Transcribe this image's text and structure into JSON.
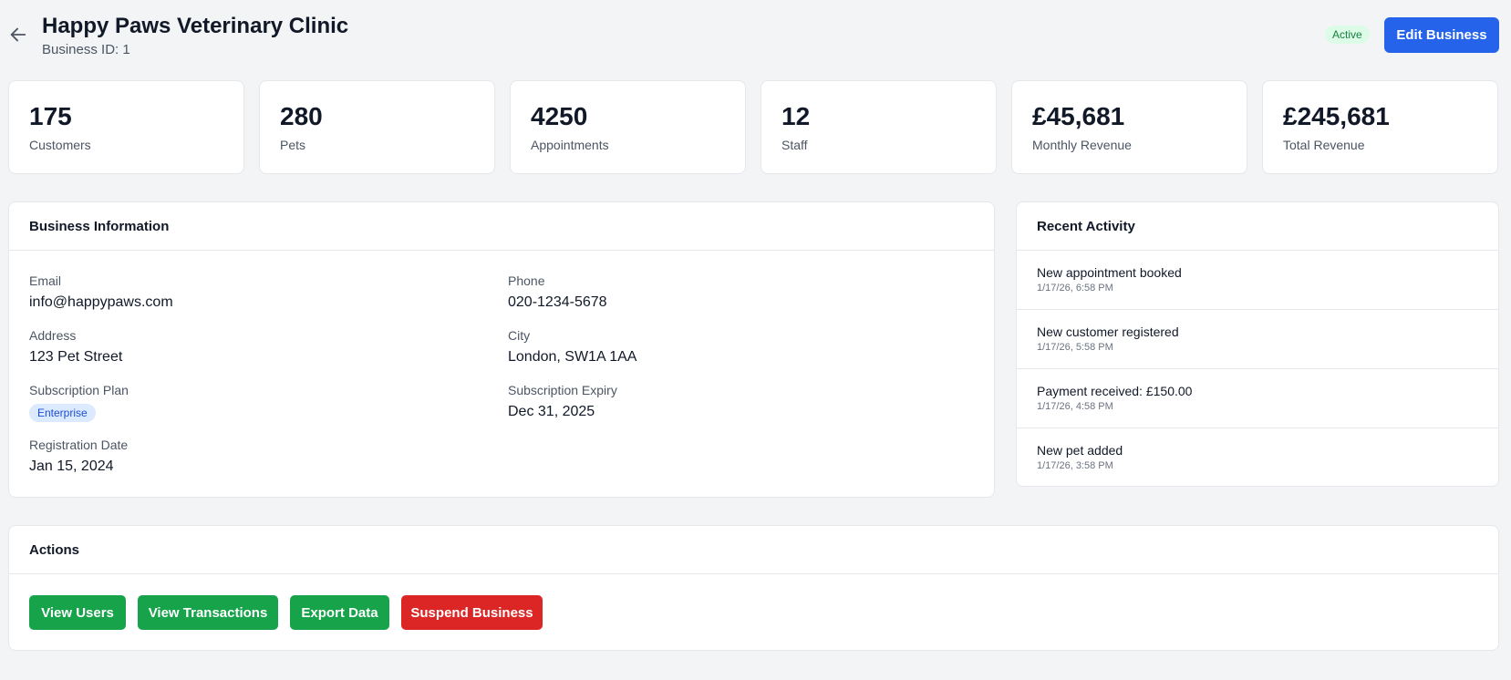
{
  "header": {
    "title": "Happy Paws Veterinary Clinic",
    "subtitle": "Business ID: 1",
    "status": "Active",
    "edit_label": "Edit Business",
    "back_icon": "arrow-left-icon"
  },
  "stats": [
    {
      "value": "175",
      "label": "Customers"
    },
    {
      "value": "280",
      "label": "Pets"
    },
    {
      "value": "4250",
      "label": "Appointments"
    },
    {
      "value": "12",
      "label": "Staff"
    },
    {
      "value": "£45,681",
      "label": "Monthly Revenue"
    },
    {
      "value": "£245,681",
      "label": "Total Revenue"
    }
  ],
  "business_info": {
    "title": "Business Information",
    "email_label": "Email",
    "email": "info@happypaws.com",
    "phone_label": "Phone",
    "phone": "020-1234-5678",
    "address_label": "Address",
    "address": "123 Pet Street",
    "city_label": "City",
    "city": "London, SW1A 1AA",
    "plan_label": "Subscription Plan",
    "plan": "Enterprise",
    "expiry_label": "Subscription Expiry",
    "expiry": "Dec 31, 2025",
    "registration_label": "Registration Date",
    "registration": "Jan 15, 2024"
  },
  "activity": {
    "title": "Recent Activity",
    "items": [
      {
        "title": "New appointment booked",
        "time": "1/17/26, 6:58 PM"
      },
      {
        "title": "New customer registered",
        "time": "1/17/26, 5:58 PM"
      },
      {
        "title": "Payment received: £150.00",
        "time": "1/17/26, 4:58 PM"
      },
      {
        "title": "New pet added",
        "time": "1/17/26, 3:58 PM"
      }
    ]
  },
  "actions": {
    "title": "Actions",
    "view_users": "View Users",
    "view_transactions": "View Transactions",
    "export_data": "Export Data",
    "suspend": "Suspend Business"
  },
  "colors": {
    "primary": "#2563eb",
    "success": "#16a34a",
    "danger": "#dc2626",
    "background": "#f3f4f6"
  }
}
